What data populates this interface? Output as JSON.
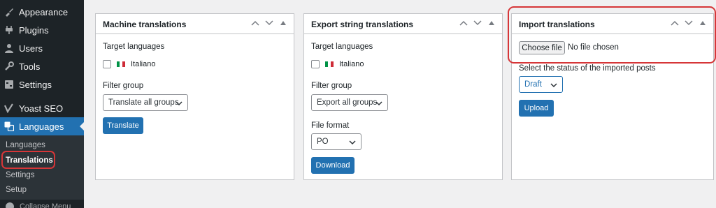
{
  "sidebar": {
    "items": [
      {
        "label": "Appearance",
        "icon": "paintbrush-icon"
      },
      {
        "label": "Plugins",
        "icon": "plugin-icon"
      },
      {
        "label": "Users",
        "icon": "users-icon"
      },
      {
        "label": "Tools",
        "icon": "wrench-icon"
      },
      {
        "label": "Settings",
        "icon": "settings-icon"
      },
      {
        "label": "Yoast SEO",
        "icon": "yoast-icon"
      },
      {
        "label": "Languages",
        "icon": "translation-icon"
      }
    ],
    "submenu": [
      "Languages",
      "Translations",
      "Settings",
      "Setup"
    ],
    "collapse_label": "Collapse Menu"
  },
  "machine": {
    "title": "Machine translations",
    "target_label": "Target languages",
    "language": "Italiano",
    "filter_label": "Filter group",
    "filter_value": "Translate all groups",
    "button": "Translate"
  },
  "export": {
    "title": "Export string translations",
    "target_label": "Target languages",
    "language": "Italiano",
    "filter_label": "Filter group",
    "filter_value": "Export all groups",
    "format_label": "File format",
    "format_value": "PO",
    "button": "Download"
  },
  "import": {
    "title": "Import translations",
    "choose_file": "Choose file",
    "no_file": "No file chosen",
    "status_label": "Select the status of the imported posts",
    "status_value": "Draft",
    "button": "Upload"
  },
  "colors": {
    "sidebar_bg": "#1d2327",
    "accent": "#2271b1",
    "highlight": "#d63638"
  }
}
